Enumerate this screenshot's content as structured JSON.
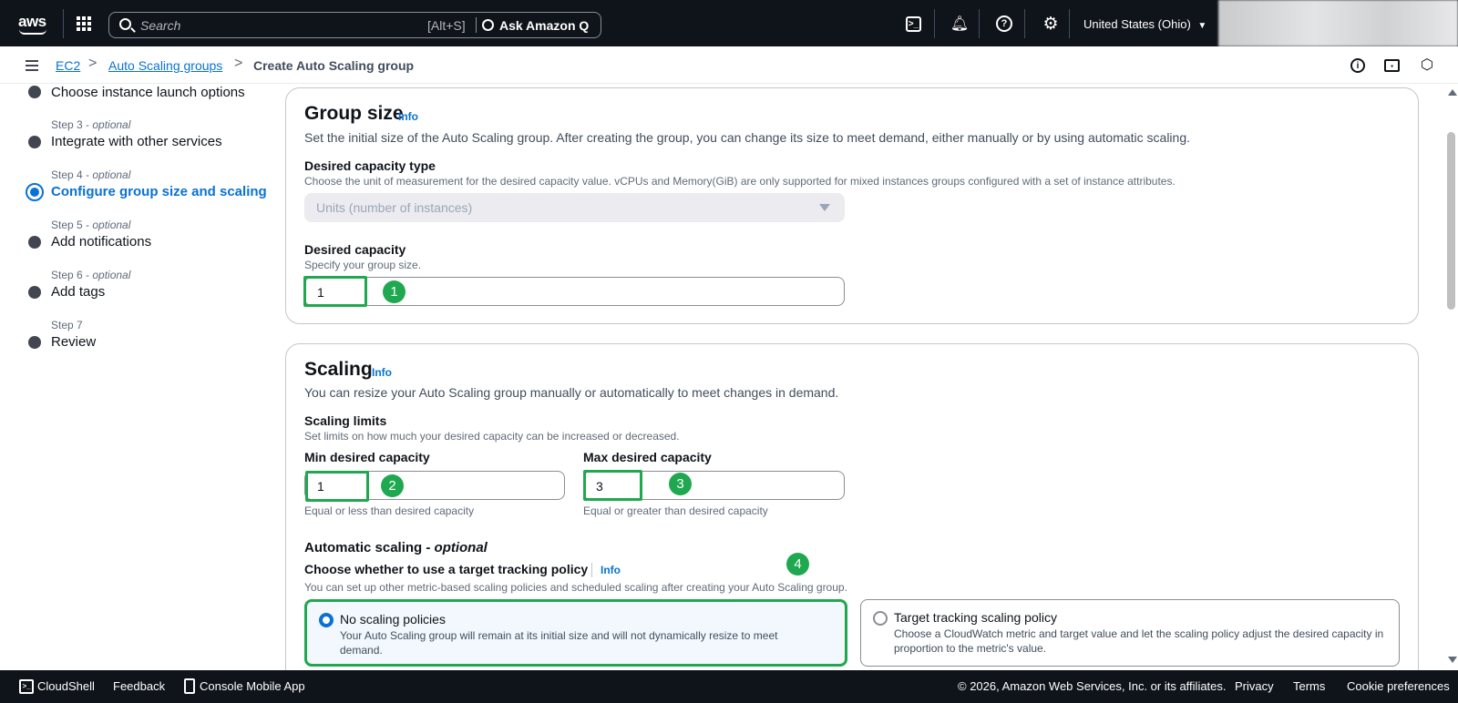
{
  "topnav": {
    "logo": "aws",
    "search_placeholder": "Search",
    "search_shortcut": "[Alt+S]",
    "ask_q": "Ask Amazon Q",
    "region": "United States (Ohio)",
    "region_caret": "▼"
  },
  "breadcrumb": {
    "items": [
      "EC2",
      "Auto Scaling groups"
    ],
    "current": "Create Auto Scaling group",
    "separator": ">"
  },
  "steps": [
    {
      "caption": "",
      "optional": "",
      "title": "Choose instance launch options"
    },
    {
      "caption": "Step 3 - ",
      "optional": "optional",
      "title": "Integrate with other services"
    },
    {
      "caption": "Step 4 - ",
      "optional": "optional",
      "title": "Configure group size and scaling"
    },
    {
      "caption": "Step 5 - ",
      "optional": "optional",
      "title": "Add notifications"
    },
    {
      "caption": "Step 6 - ",
      "optional": "optional",
      "title": "Add tags"
    },
    {
      "caption": "Step 7",
      "optional": "",
      "title": "Review"
    }
  ],
  "group_size": {
    "title": "Group size",
    "info": "Info",
    "description": "Set the initial size of the Auto Scaling group. After creating the group, you can change its size to meet demand, either manually or by using automatic scaling.",
    "capacity_type_label": "Desired capacity type",
    "capacity_type_desc": "Choose the unit of measurement for the desired capacity value. vCPUs and Memory(GiB) are only supported for mixed instances groups configured with a set of instance attributes.",
    "capacity_type_value": "Units (number of instances)",
    "desired_label": "Desired capacity",
    "desired_desc": "Specify your group size.",
    "desired_value": "1"
  },
  "scaling": {
    "title": "Scaling",
    "info": "Info",
    "description": "You can resize your Auto Scaling group manually or automatically to meet changes in demand.",
    "limits_label": "Scaling limits",
    "limits_desc": "Set limits on how much your desired capacity can be increased or decreased.",
    "min_label": "Min desired capacity",
    "min_value": "1",
    "min_hint": "Equal or less than desired capacity",
    "max_label": "Max desired capacity",
    "max_value": "3",
    "max_hint": "Equal or greater than desired capacity",
    "auto_label": "Automatic scaling - ",
    "auto_optional": "optional",
    "policy_question": "Choose whether to use a target tracking policy",
    "policy_info": "Info",
    "policy_desc": "You can set up other metric-based scaling policies and scheduled scaling after creating your Auto Scaling group.",
    "options": [
      {
        "title": "No scaling policies",
        "desc": "Your Auto Scaling group will remain at its initial size and will not dynamically resize to meet demand.",
        "selected": true
      },
      {
        "title": "Target tracking scaling policy",
        "desc": "Choose a CloudWatch metric and target value and let the scaling policy adjust the desired capacity in proportion to the metric's value.",
        "selected": false
      }
    ]
  },
  "annotations": [
    "1",
    "2",
    "3",
    "4"
  ],
  "annotation_color": "#1fa84f",
  "accent_color": "#0972d3",
  "footer": {
    "cloudshell": "CloudShell",
    "feedback": "Feedback",
    "mobile": "Console Mobile App",
    "copyright": "© 2026, Amazon Web Services, Inc. or its affiliates.",
    "privacy": "Privacy",
    "terms": "Terms",
    "cookies": "Cookie preferences"
  }
}
